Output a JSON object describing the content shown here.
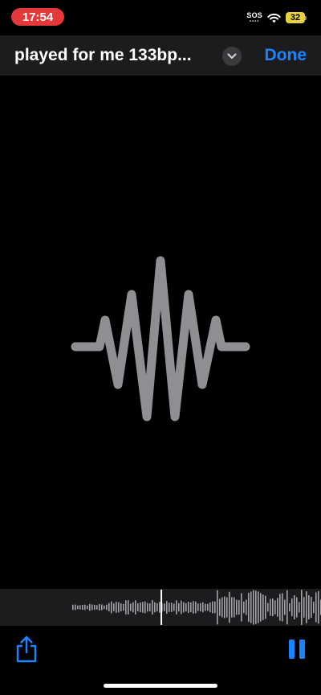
{
  "status_bar": {
    "time": "17:54",
    "carrier_label": "SOS",
    "battery_level": "32",
    "colors": {
      "time_pill": "#e5383b",
      "battery": "#e7d23b"
    }
  },
  "nav": {
    "title": "played for me 133bp...",
    "done_label": "Done",
    "accent_color": "#1a84ff"
  },
  "icons": {
    "wave": "waveform-icon",
    "chevron": "chevron-down-icon",
    "share": "share-icon",
    "pause": "pause-icon",
    "wifi": "wifi-icon",
    "battery": "battery-icon"
  },
  "playback": {
    "state": "playing",
    "progress": 0.36
  }
}
